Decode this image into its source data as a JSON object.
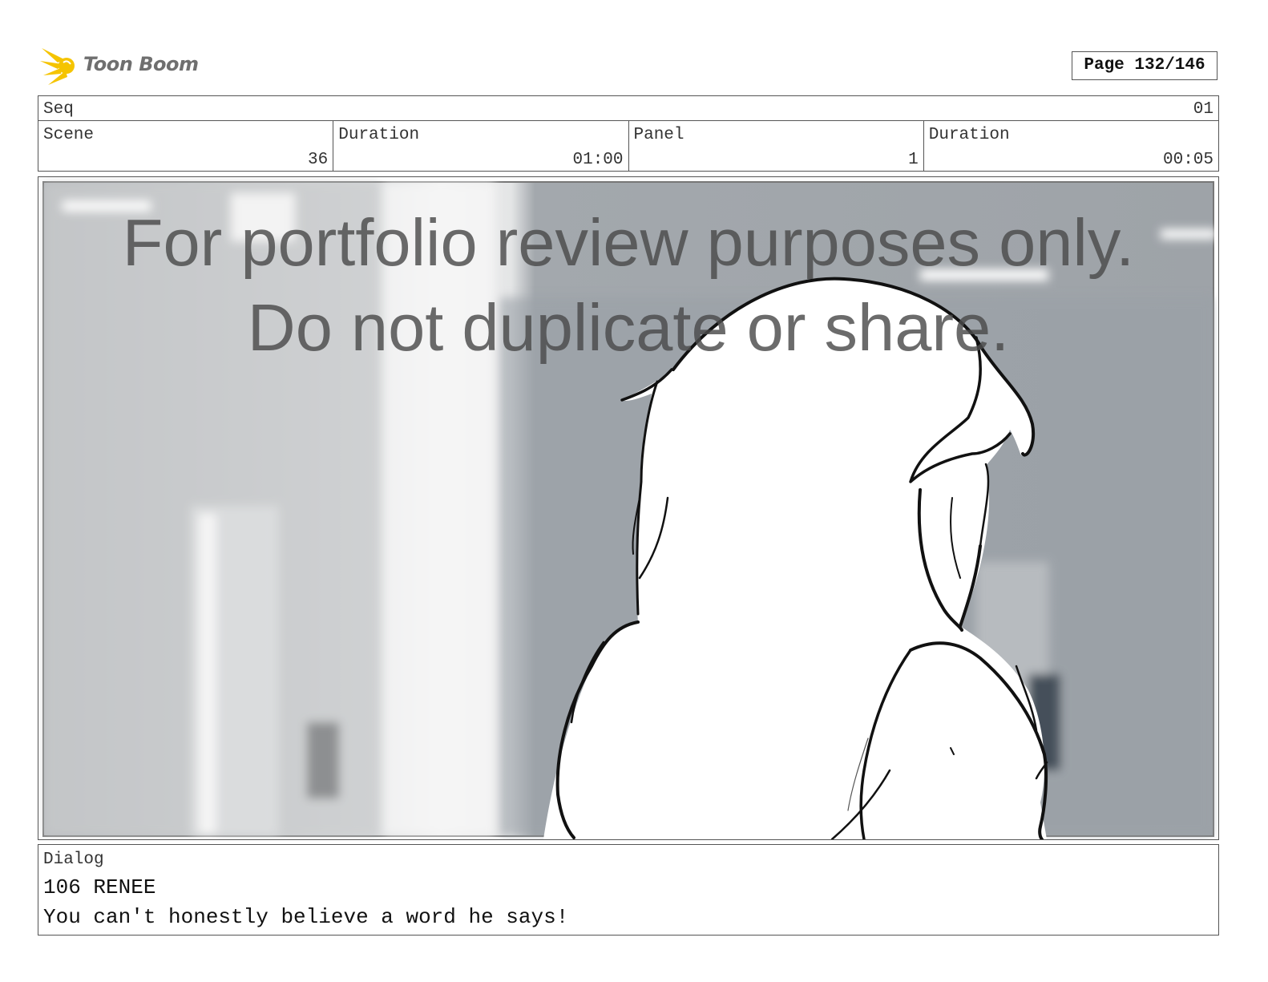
{
  "header": {
    "logo_text": "Toon Boom",
    "page_label": "Page 132/146"
  },
  "seq": {
    "label": "Seq",
    "value": "01"
  },
  "info": [
    {
      "label": "Scene",
      "value": "36"
    },
    {
      "label": "Duration",
      "value": "01:00"
    },
    {
      "label": "Panel",
      "value": "1"
    },
    {
      "label": "Duration",
      "value": "00:05"
    }
  ],
  "watermark": {
    "line1": "For portfolio review purposes only.",
    "line2": "Do not duplicate or share."
  },
  "dialog": {
    "label": "Dialog",
    "line1": "106 RENEE",
    "line2": "You can't honestly believe a word he says!"
  },
  "colors": {
    "logo_accent": "#f5c400",
    "frame_border": "#555555"
  },
  "icons": {
    "logo": "toon-boom-star-icon"
  }
}
